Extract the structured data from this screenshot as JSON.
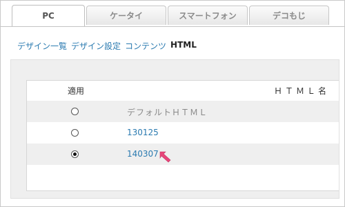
{
  "tabs": [
    {
      "label": "PC",
      "active": true
    },
    {
      "label": "ケータイ",
      "active": false
    },
    {
      "label": "スマートフォン",
      "active": false
    },
    {
      "label": "デコもじ",
      "active": false
    }
  ],
  "breadcrumb": {
    "links": [
      "デザイン一覧",
      "デザイン設定",
      "コンテンツ"
    ],
    "current": "HTML"
  },
  "table": {
    "col_apply": "適用",
    "col_name": "ＨＴＭＬ名",
    "rows": [
      {
        "name": "デフォルトＨＴＭＬ",
        "selected": false,
        "is_link": false
      },
      {
        "name": "130125",
        "selected": false,
        "is_link": true
      },
      {
        "name": "140307",
        "selected": true,
        "is_link": true
      }
    ]
  },
  "colors": {
    "link": "#2a7ab0",
    "annotation_arrow": "#e8457a"
  },
  "icons": {
    "pointer": "arrow-pointer-icon"
  }
}
